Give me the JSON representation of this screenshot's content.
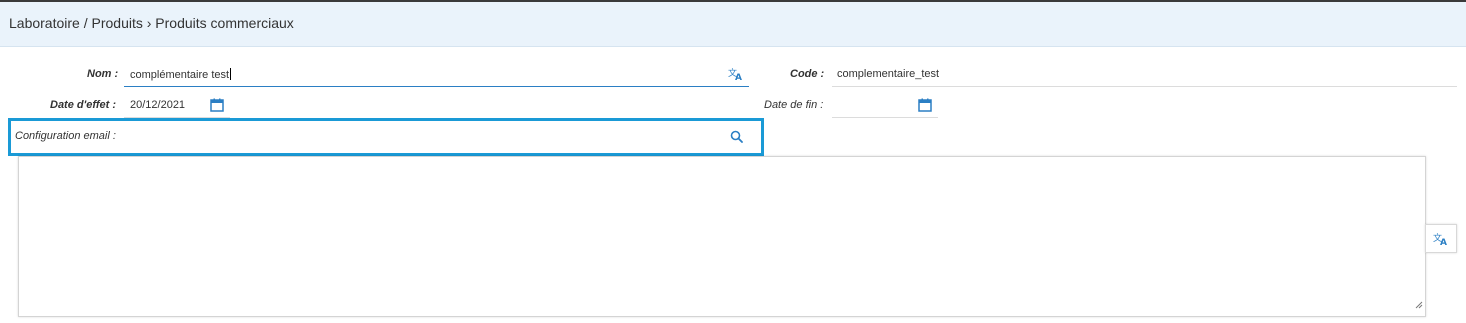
{
  "breadcrumb": "Laboratoire / Produits › Produits commerciaux",
  "form": {
    "nom_label": "Nom :",
    "nom_value": "complémentaire test",
    "code_label": "Code :",
    "code_value": "complementaire_test",
    "date_effet_label": "Date d'effet :",
    "date_effet_value": "20/12/2021",
    "date_fin_label": "Date de fin :",
    "date_fin_value": "",
    "config_email_label": "Configuration email :",
    "config_email_value": ""
  },
  "icons": {
    "translate": "translate-icon",
    "calendar": "calendar-icon",
    "search": "search-icon",
    "resize": "resize-handle-icon"
  },
  "colors": {
    "accent": "#2b7fc4",
    "highlight": "#1a9ad6",
    "header_bg": "#eaf3fb"
  }
}
